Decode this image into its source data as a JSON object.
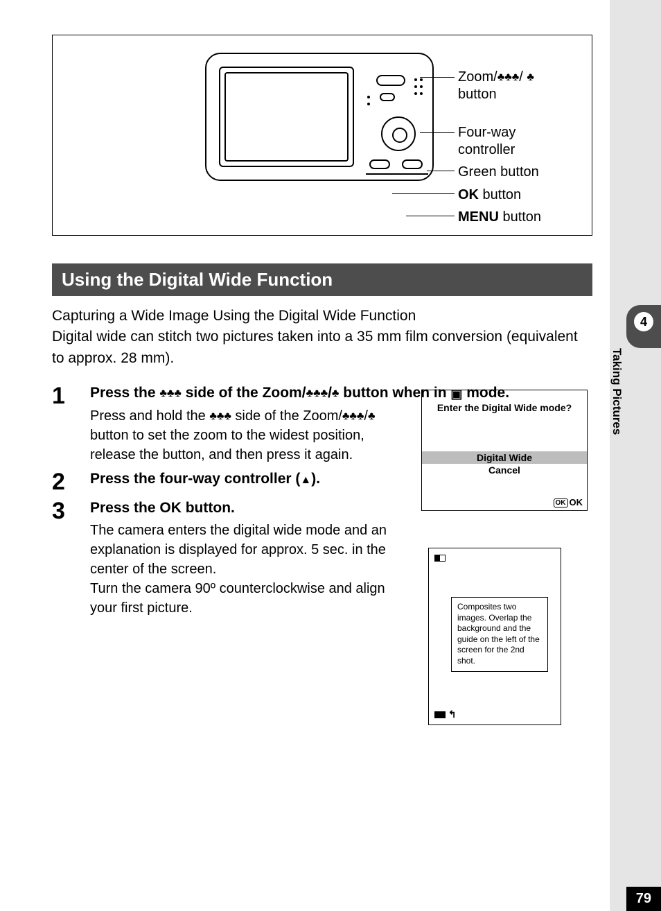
{
  "page_number": "79",
  "side_tab": {
    "chapter_num": "4",
    "chapter_title": "Taking Pictures"
  },
  "diagram_labels": {
    "zoom": "Zoom/",
    "zoom_suffix": "button",
    "fourway": "Four-way controller",
    "green": "Green button",
    "ok_prefix": "OK",
    "ok_suffix": " button",
    "menu_prefix": "MENU",
    "menu_suffix": " button"
  },
  "section_title": "Using the Digital Wide Function",
  "intro": "Capturing a Wide Image Using the Digital Wide Function\nDigital wide can stitch two pictures taken into a 35 mm film conversion (equivalent to approx. 28 mm).",
  "steps": [
    {
      "num": "1",
      "title_parts": [
        "Press the ",
        " side of the Zoom/",
        "/",
        " button when in ",
        " mode."
      ],
      "desc_parts": [
        "Press and hold the ",
        " side of the Zoom/",
        "/",
        " button to set the zoom to the widest position, release the button, and then press it again."
      ]
    },
    {
      "num": "2",
      "title_parts": [
        "Press the four-way controller (",
        ")."
      ]
    },
    {
      "num": "3",
      "title_parts": [
        "Press the ",
        "OK",
        " button."
      ],
      "desc_plain": "The camera enters the digital wide mode and an explanation is displayed for approx. 5 sec. in the center of the screen.\nTurn the camera 90º counterclockwise and align your first picture."
    }
  ],
  "inset1": {
    "prompt": "Enter the Digital Wide mode?",
    "opt_selected": "Digital Wide",
    "opt_other": "Cancel",
    "ok_label": "OK"
  },
  "inset2": {
    "message": "Composites two images. Overlap the background and the guide on the left of the screen for the 2nd shot."
  }
}
